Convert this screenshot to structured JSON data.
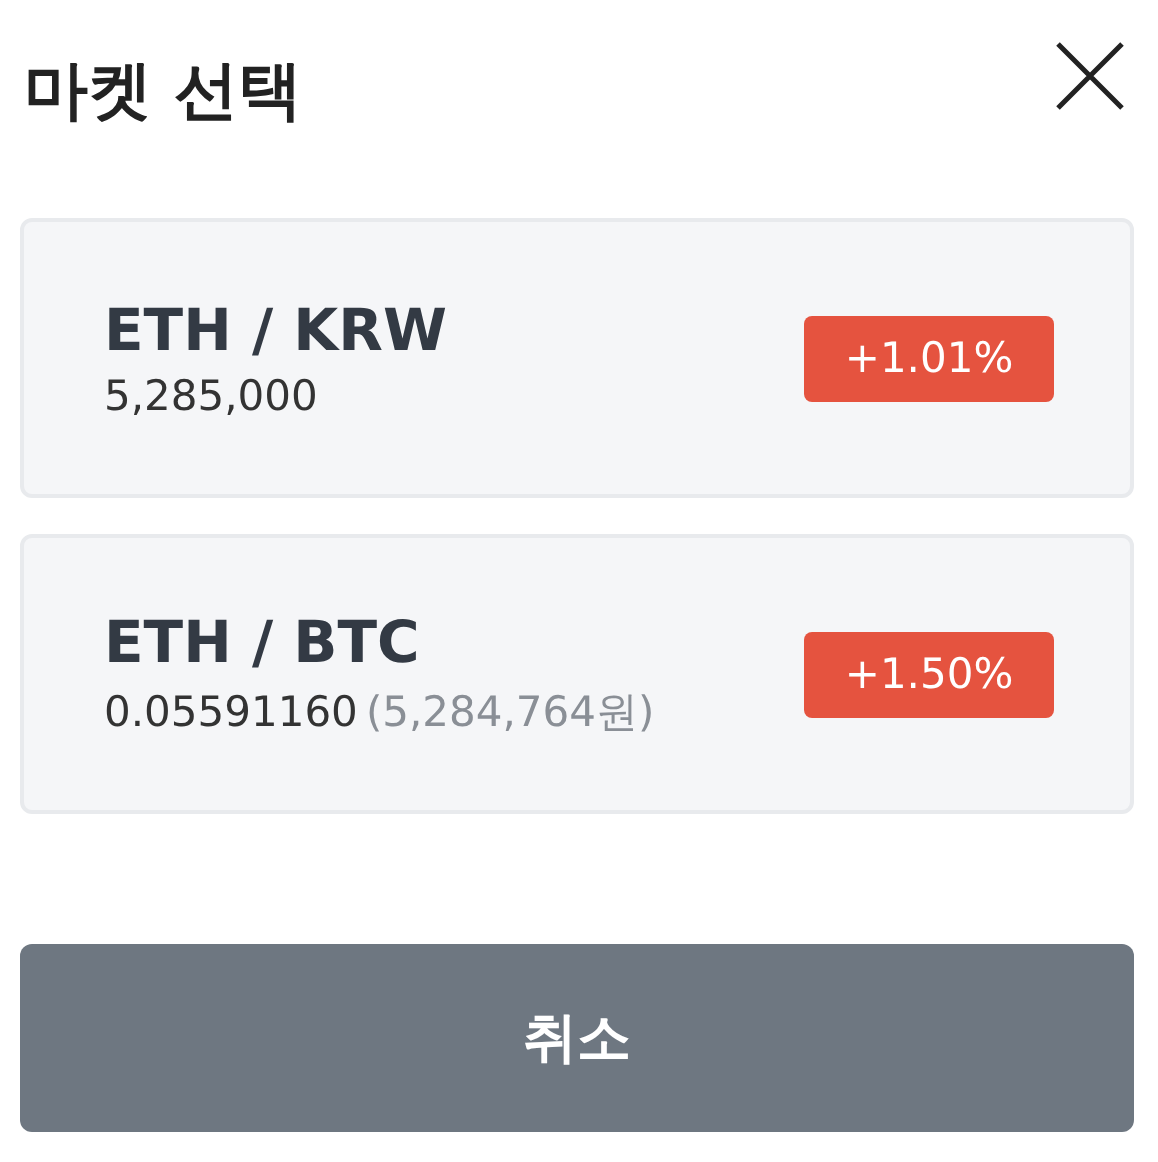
{
  "title": "마켓 선택",
  "markets": [
    {
      "pair": "ETH / KRW",
      "price": "5,285,000",
      "change": "+1.01%"
    },
    {
      "pair": "ETH / BTC",
      "price": "0.05591160",
      "price_note": "(5,284,764원)",
      "change": "+1.50%"
    }
  ],
  "cancel_button": "취소"
}
